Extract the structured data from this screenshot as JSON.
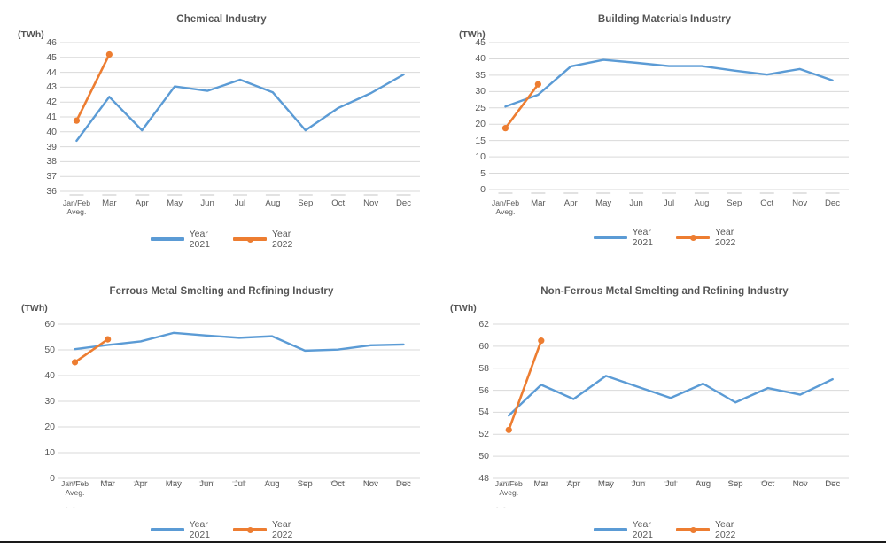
{
  "legend": {
    "series_2021_label_line1": "Year",
    "series_2021_label_line2": "2021",
    "series_2022_label_line1": "Year",
    "series_2022_label_line2": "2022"
  },
  "colors": {
    "series_2021": "#5B9BD5",
    "series_2022": "#ED7D31",
    "gridline": "#D9D9D9",
    "text": "#595959",
    "title": "#555555"
  },
  "axis_unit": "(TWh)",
  "ghost_text": "- -",
  "chart_data": [
    {
      "type": "line",
      "title": "Chemical Industry",
      "xlabel": "",
      "ylabel": "(TWh)",
      "ylim": [
        36,
        46
      ],
      "yticks": [
        36,
        37,
        38,
        39,
        40,
        41,
        42,
        43,
        44,
        45,
        46
      ],
      "grid": true,
      "legend_position": "bottom",
      "categories": [
        "Jan/Feb Aveg.",
        "Mar",
        "Apr",
        "May",
        "Jun",
        "Jul",
        "Aug",
        "Sep",
        "Oct",
        "Nov",
        "Dec"
      ],
      "series": [
        {
          "name": "Year 2021",
          "color": "#5B9BD5",
          "markers": false,
          "values": [
            39.4,
            42.35,
            40.1,
            43.05,
            42.75,
            43.5,
            42.65,
            40.1,
            41.6,
            42.6,
            43.85
          ]
        },
        {
          "name": "Year 2022",
          "color": "#ED7D31",
          "markers": true,
          "values": [
            40.75,
            45.2,
            null,
            null,
            null,
            null,
            null,
            null,
            null,
            null,
            null
          ]
        }
      ]
    },
    {
      "type": "line",
      "title": "Building Materials Industry",
      "xlabel": "",
      "ylabel": "(TWh)",
      "ylim": [
        0,
        45
      ],
      "yticks": [
        0,
        5,
        10,
        15,
        20,
        25,
        30,
        35,
        40,
        45
      ],
      "grid": true,
      "legend_position": "bottom",
      "categories": [
        "Jan/Feb Aveg.",
        "Mar",
        "Apr",
        "May",
        "Jun",
        "Jul",
        "Aug",
        "Sep",
        "Oct",
        "Nov",
        "Dec"
      ],
      "series": [
        {
          "name": "Year 2021",
          "color": "#5B9BD5",
          "markers": false,
          "values": [
            25.4,
            29.0,
            37.7,
            39.7,
            38.8,
            37.8,
            37.8,
            36.4,
            35.2,
            36.9,
            33.4
          ]
        },
        {
          "name": "Year 2022",
          "color": "#ED7D31",
          "markers": true,
          "values": [
            18.8,
            32.2,
            null,
            null,
            null,
            null,
            null,
            null,
            null,
            null,
            null
          ]
        }
      ]
    },
    {
      "type": "line",
      "title": "Ferrous Metal Smelting and Refining Industry",
      "xlabel": "",
      "ylabel": "(TWh)",
      "ylim": [
        0,
        60
      ],
      "yticks": [
        0,
        10,
        20,
        30,
        40,
        50,
        60
      ],
      "grid": true,
      "legend_position": "bottom",
      "categories": [
        "Jan/Feb Aveg.",
        "Mar",
        "Apr",
        "May",
        "Jun",
        "Jul",
        "Aug",
        "Sep",
        "Oct",
        "Nov",
        "Dec"
      ],
      "series": [
        {
          "name": "Year 2021",
          "color": "#5B9BD5",
          "markers": false,
          "values": [
            50.3,
            51.9,
            53.3,
            56.6,
            55.6,
            54.7,
            55.3,
            49.7,
            50.1,
            51.8,
            52.1
          ]
        },
        {
          "name": "Year 2022",
          "color": "#ED7D31",
          "markers": true,
          "values": [
            45.2,
            54.1,
            null,
            null,
            null,
            null,
            null,
            null,
            null,
            null,
            null
          ]
        }
      ]
    },
    {
      "type": "line",
      "title": "Non-Ferrous Metal Smelting and Refining Industry",
      "xlabel": "",
      "ylabel": "(TWh)",
      "ylim": [
        48,
        62
      ],
      "yticks": [
        48,
        50,
        52,
        54,
        56,
        58,
        60,
        62
      ],
      "grid": true,
      "legend_position": "bottom",
      "categories": [
        "Jan/Feb Aveg.",
        "Mar",
        "Apr",
        "May",
        "Jun",
        "Jul",
        "Aug",
        "Sep",
        "Oct",
        "Nov",
        "Dec"
      ],
      "series": [
        {
          "name": "Year 2021",
          "color": "#5B9BD5",
          "markers": false,
          "values": [
            53.7,
            56.5,
            55.2,
            57.3,
            56.3,
            55.3,
            56.6,
            54.9,
            56.2,
            55.6,
            57.0
          ]
        },
        {
          "name": "Year 2022",
          "color": "#ED7D31",
          "markers": true,
          "values": [
            52.4,
            60.5,
            null,
            null,
            null,
            null,
            null,
            null,
            null,
            null,
            null
          ]
        }
      ]
    }
  ]
}
